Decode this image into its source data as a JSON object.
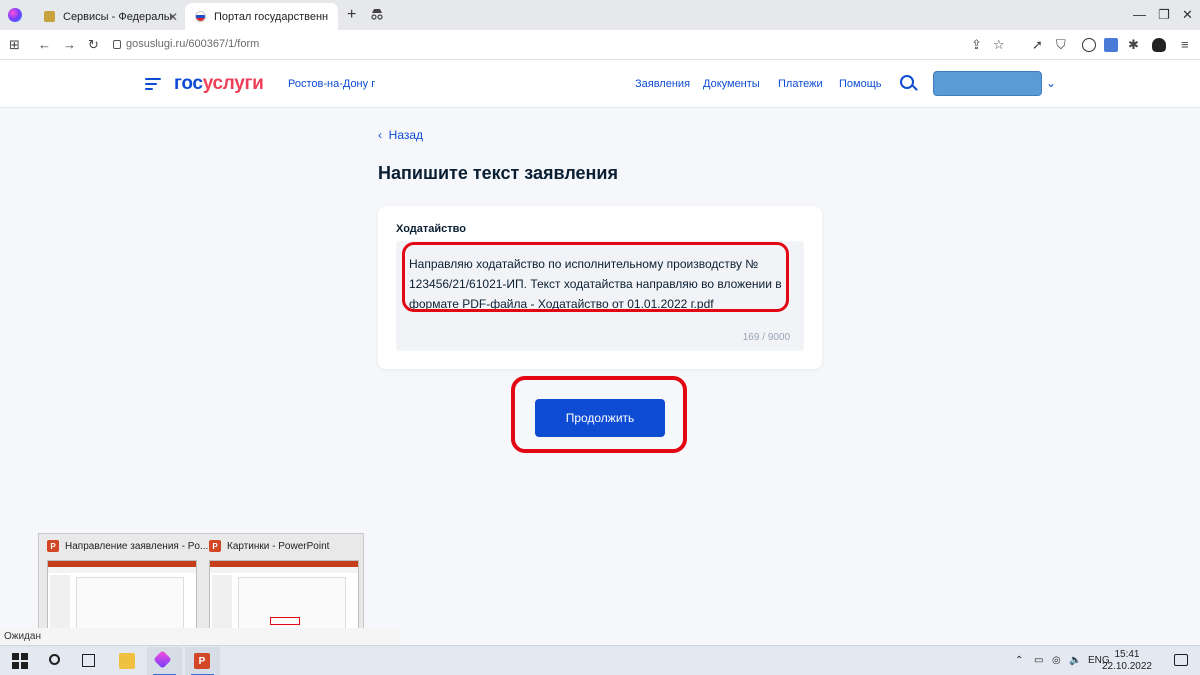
{
  "browser": {
    "tabs": [
      {
        "label": "Сервисы - Федеральная слу"
      },
      {
        "label": "Портал государственных усл"
      }
    ],
    "url": "gosuslugi.ru/600367/1/form"
  },
  "site": {
    "logo_part1": "гос",
    "logo_part2": "услуги",
    "region": "Ростов-на-Дону г",
    "nav": [
      "Заявления",
      "Документы",
      "Платежи",
      "Помощь"
    ]
  },
  "main": {
    "back_label": "Назад",
    "title": "Напишите текст заявления",
    "field_label": "Ходатайство",
    "field_value": "Направляю ходатайство по исполнительному производству № 123456/21/61021-ИП. Текст ходатайства направляю во вложении в формате PDF-файла - Ходатайство от 01.01.2022 г.pdf",
    "counter": "169 / 9000",
    "continue_label": "Продолжить"
  },
  "taskbar_preview": {
    "items": [
      {
        "title": "Направление заявления - Po..."
      },
      {
        "title": "Картинки - PowerPoint"
      }
    ]
  },
  "status_text": "Ожидан",
  "system": {
    "language": "ENG",
    "time": "15:41",
    "date": "22.10.2022"
  },
  "colors": {
    "brand_blue": "#0d4cd3",
    "brand_red": "#ee3f58",
    "highlight_red": "#e30613"
  }
}
